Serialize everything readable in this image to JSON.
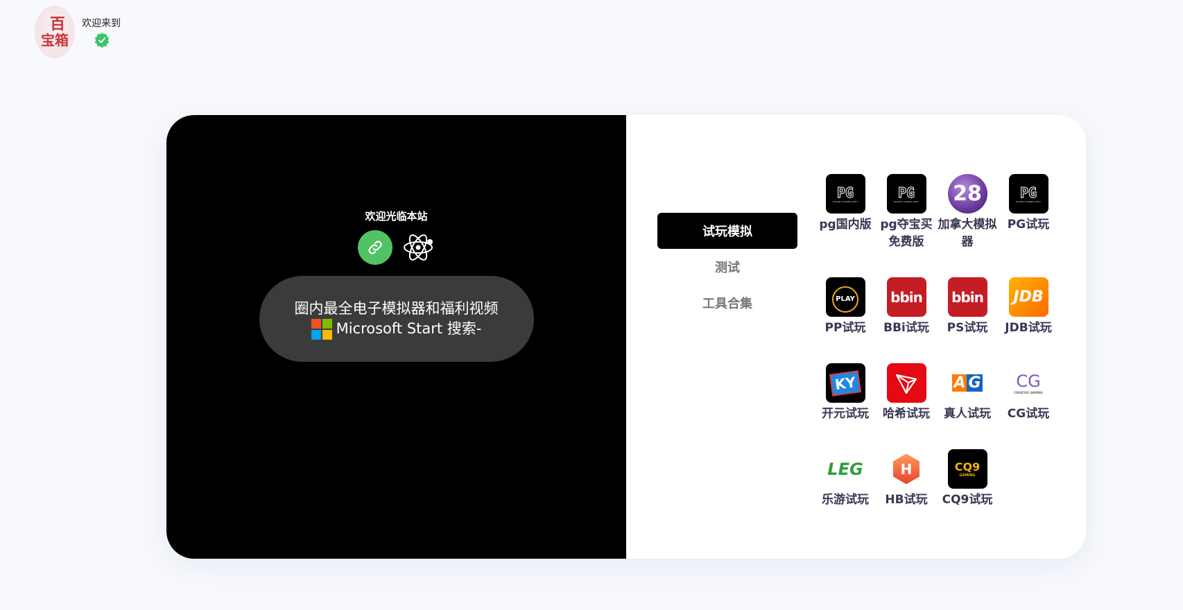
{
  "header": {
    "logo_big": "百",
    "logo_row": [
      "宝",
      "箱"
    ],
    "welcome": "欢迎来到"
  },
  "left": {
    "title": "欢迎光临本站",
    "pill_line1": "圈内最全电子模拟器和福利视频",
    "pill_line2": "Microsoft Start 搜索-"
  },
  "tabs": [
    "试玩模拟",
    "测试",
    "工具合集"
  ],
  "apps": [
    [
      {
        "label": "pg国内版",
        "icon": "PG"
      },
      {
        "label": "pg夺宝买免费版",
        "icon": "PG"
      },
      {
        "label": "加拿大模拟器",
        "icon": "28"
      },
      {
        "label": "PG试玩",
        "icon": "PG"
      }
    ],
    [
      {
        "label": "PP试玩",
        "icon": "PLAY"
      },
      {
        "label": "BBi试玩",
        "icon": "bbin"
      },
      {
        "label": "PS试玩",
        "icon": "bbin"
      },
      {
        "label": "JDB试玩",
        "icon": "JDB"
      }
    ],
    [
      {
        "label": "开元试玩",
        "icon": "KY"
      },
      {
        "label": "哈希试玩",
        "icon": "tron"
      },
      {
        "label": "真人试玩",
        "icon": "AG"
      },
      {
        "label": "CG试玩",
        "icon": "CG"
      }
    ],
    [
      {
        "label": "乐游试玩",
        "icon": "LEG"
      },
      {
        "label": "HB试玩",
        "icon": "H"
      },
      {
        "label": "CQ9试玩",
        "icon": "CQ9"
      }
    ]
  ]
}
